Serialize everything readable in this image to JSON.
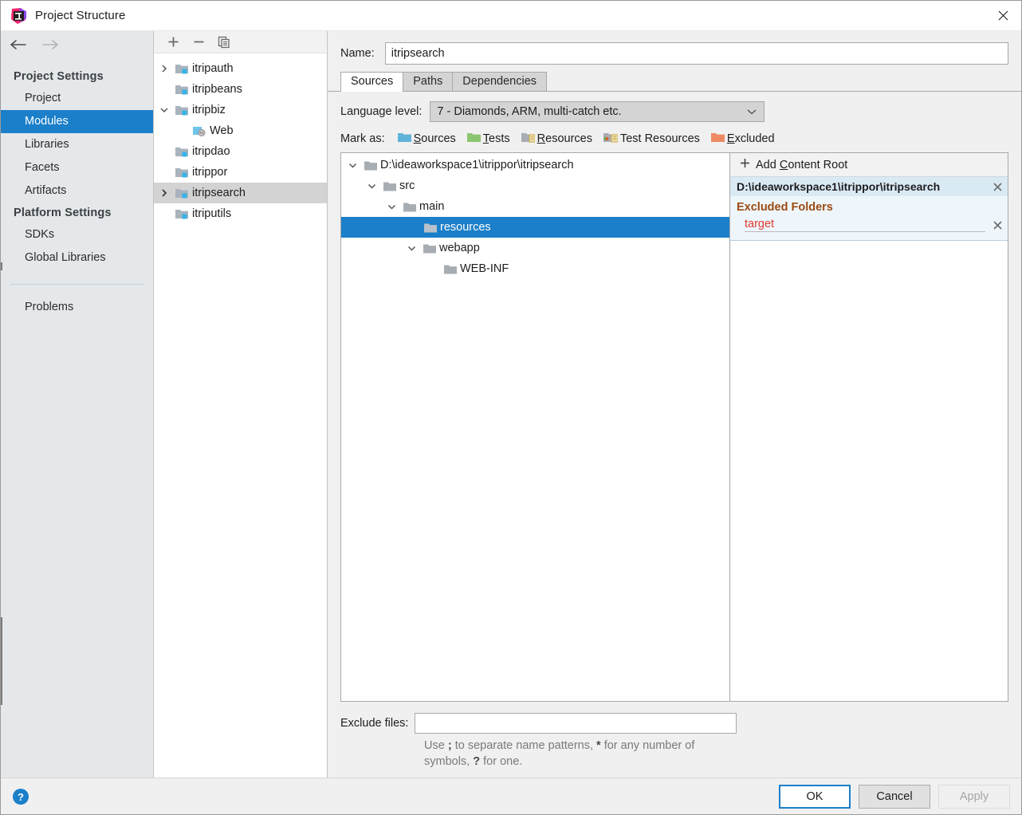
{
  "window": {
    "title": "Project Structure",
    "app_icon": "intellij-idea-logo",
    "close_icon": "close-icon"
  },
  "sidebar": {
    "back_icon": "arrow-left-icon",
    "forward_icon": "arrow-right-icon",
    "groups": [
      {
        "label": "Project Settings",
        "items": [
          {
            "label": "Project",
            "selected": false
          },
          {
            "label": "Modules",
            "selected": true
          },
          {
            "label": "Libraries",
            "selected": false
          },
          {
            "label": "Facets",
            "selected": false
          },
          {
            "label": "Artifacts",
            "selected": false
          }
        ]
      },
      {
        "label": "Platform Settings",
        "items": [
          {
            "label": "SDKs",
            "selected": false
          },
          {
            "label": "Global Libraries",
            "selected": false
          }
        ]
      }
    ],
    "extra_items": [
      {
        "label": "Problems",
        "selected": false
      }
    ]
  },
  "modules": {
    "toolbar": [
      {
        "icon": "plus-icon",
        "name": "add-module-button"
      },
      {
        "icon": "minus-icon",
        "name": "remove-module-button"
      },
      {
        "icon": "copy-icon",
        "name": "copy-module-button"
      }
    ],
    "tree": [
      {
        "label": "itripauth",
        "twisty": "collapsed",
        "icon": "module-folder-icon",
        "depth": 0,
        "selected": false
      },
      {
        "label": "itripbeans",
        "twisty": "none",
        "icon": "module-folder-icon",
        "depth": 0,
        "selected": false
      },
      {
        "label": "itripbiz",
        "twisty": "expanded",
        "icon": "module-folder-icon",
        "depth": 0,
        "selected": false
      },
      {
        "label": "Web",
        "twisty": "none",
        "icon": "web-facet-icon",
        "depth": 1,
        "selected": false
      },
      {
        "label": "itripdao",
        "twisty": "none",
        "icon": "module-folder-icon",
        "depth": 0,
        "selected": false
      },
      {
        "label": "itrippor",
        "twisty": "none",
        "icon": "module-folder-icon",
        "depth": 0,
        "selected": false
      },
      {
        "label": "itripsearch",
        "twisty": "collapsed",
        "icon": "module-folder-icon",
        "depth": 0,
        "selected": true
      },
      {
        "label": "itriputils",
        "twisty": "none",
        "icon": "module-folder-icon",
        "depth": 0,
        "selected": false
      }
    ]
  },
  "detail": {
    "name_label": "Name:",
    "name_value": "itripsearch",
    "tabs": [
      {
        "label": "Sources",
        "active": true
      },
      {
        "label": "Paths",
        "active": false
      },
      {
        "label": "Dependencies",
        "active": false
      }
    ],
    "language_level_label": "Language level:",
    "language_level_value": "7 - Diamonds, ARM, multi-catch etc.",
    "mark_as_label": "Mark as:",
    "mark_as_buttons": [
      {
        "mnemonic": "S",
        "rest": "ources",
        "icon": "sources-folder-icon",
        "color": "#5fb3da"
      },
      {
        "mnemonic": "T",
        "rest": "ests",
        "icon": "tests-folder-icon",
        "color": "#8cc571"
      },
      {
        "mnemonic": "R",
        "rest": "esources",
        "icon": "resources-folder-icon",
        "color": "#a8adb3"
      },
      {
        "mnemonic": "",
        "rest": "Test Resources",
        "icon": "test-resources-folder-icon",
        "color": "#a8adb3"
      },
      {
        "mnemonic": "E",
        "rest": "xcluded",
        "icon": "excluded-folder-icon",
        "color": "#ed8a63"
      }
    ],
    "source_tree": [
      {
        "label": "D:\\ideaworkspace1\\itrippor\\itripsearch",
        "twisty": "expanded",
        "depth": 0,
        "selected": false
      },
      {
        "label": "src",
        "twisty": "expanded",
        "depth": 1,
        "selected": false
      },
      {
        "label": "main",
        "twisty": "expanded",
        "depth": 2,
        "selected": false
      },
      {
        "label": "resources",
        "twisty": "none",
        "depth": 3,
        "selected": true
      },
      {
        "label": "webapp",
        "twisty": "expanded",
        "depth": 2,
        "selected": false
      },
      {
        "label": "WEB-INF",
        "twisty": "none",
        "depth": 3,
        "selected": false
      }
    ],
    "content_roots": {
      "add_label_mnemonic": "C",
      "add_label_before": "Add ",
      "add_label_after": "ontent Root",
      "add_icon": "plus-icon",
      "roots": [
        {
          "path": "D:\\ideaworkspace1\\itrippor\\itripsearch",
          "remove_icon": "close-icon",
          "sections": [
            {
              "title": "Excluded Folders",
              "entries": [
                {
                  "name": "target",
                  "remove_icon": "close-icon"
                }
              ]
            }
          ]
        }
      ]
    },
    "exclude_files_label": "Exclude files:",
    "exclude_files_value": "",
    "exclude_hint_1": "Use ",
    "exclude_hint_semicolon": ";",
    "exclude_hint_2": " to separate name patterns, ",
    "exclude_hint_star": "*",
    "exclude_hint_3": " for any number of symbols, ",
    "exclude_hint_question": "?",
    "exclude_hint_4": " for one."
  },
  "footer": {
    "help_icon": "help-icon",
    "ok_label": "OK",
    "cancel_label": "Cancel",
    "apply_label": "Apply"
  },
  "colors": {
    "selection_blue": "#1b7fc9",
    "sidebar_bg": "#e4e8eb",
    "content_root_header_bg": "#daeaf5",
    "content_root_body_bg": "#eef6fc",
    "excluded_title": "#9c4a12",
    "excluded_entry": "#e03a2f"
  }
}
